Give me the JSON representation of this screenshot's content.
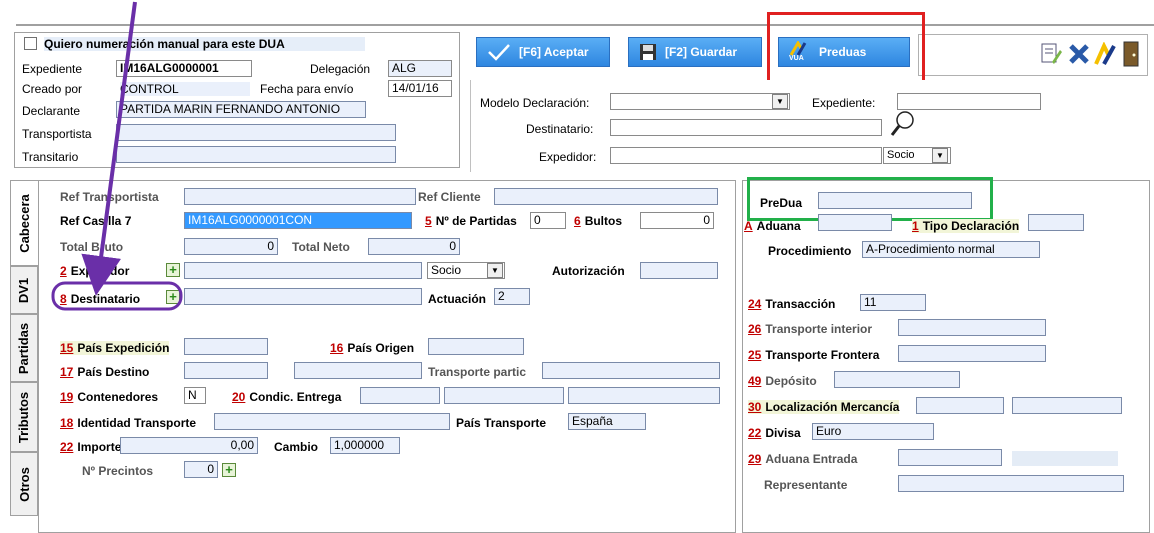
{
  "header": {
    "manual_numbering_label": "Quiero numeración manual para este DUA",
    "expediente_label": "Expediente",
    "expediente_value": "IM16ALG0000001",
    "delegacion_label": "Delegación",
    "delegacion_value": "ALG",
    "creado_label": "Creado por",
    "creado_value": "CONTROL",
    "fecha_label": "Fecha para envío",
    "fecha_value": "14/01/16",
    "declarante_label": "Declarante",
    "declarante_value": "PARTIDA MARIN FERNANDO ANTONIO",
    "transportista_label": "Transportista",
    "transitario_label": "Transitario"
  },
  "toolbar": {
    "aceptar_label": "[F6] Aceptar",
    "guardar_label": "[F2] Guardar",
    "preduas_label": "Preduas",
    "vua_badge": "VUA"
  },
  "search": {
    "modelo_label": "Modelo Declaración:",
    "expediente_label": "Expediente:",
    "destinatario_label": "Destinatario:",
    "expedidor_label": "Expedidor:",
    "socio_value": "Socio"
  },
  "tabs": [
    {
      "label": "Cabecera"
    },
    {
      "label": "DV1"
    },
    {
      "label": "Partidas"
    },
    {
      "label": "Tributos"
    },
    {
      "label": "Otros"
    }
  ],
  "left_form": {
    "ref_transportista": "Ref Transportista",
    "ref_cliente": "Ref Cliente",
    "ref_casilla": "Ref Casilla 7",
    "ref_casilla_value": "IM16ALG0000001CON",
    "n_partidas_num": "5",
    "n_partidas_label": "Nº de Partidas",
    "n_partidas_value": "0",
    "bultos_num": "6",
    "bultos_label": "Bultos",
    "bultos_value": "0",
    "total_bruto": "Total Bruto",
    "total_bruto_value": "0",
    "total_neto": "Total Neto",
    "total_neto_value": "0",
    "expedidor_num": "2",
    "expedidor_label": "Expedidor",
    "socio_value": "Socio",
    "autorizacion": "Autorización",
    "destinatario_num": "8",
    "destinatario_label": "Destinatario",
    "actuacion_label": "Actuación",
    "actuacion_value": "2",
    "pais_exp_num": "15",
    "pais_exp_label": "País Expedición",
    "pais_origen_num": "16",
    "pais_origen_label": "País Origen",
    "pais_destino_num": "17",
    "pais_destino_label": "País Destino",
    "transporte_partic": "Transporte partic",
    "contenedores_num": "19",
    "contenedores_label": "Contenedores",
    "contenedores_value": "N",
    "condic_num": "20",
    "condic_label": "Condic. Entrega",
    "identidad_num": "18",
    "identidad_label": "Identidad Transporte",
    "pais_transporte_label": "País Transporte",
    "pais_transporte_value": "España",
    "importe_num": "22",
    "importe_label": "Importe",
    "importe_value": "0,00",
    "cambio_label": "Cambio",
    "cambio_value": "1,000000",
    "precintos_label": "Nº Precintos",
    "precintos_value": "0"
  },
  "right_form": {
    "predua_label": "PreDua",
    "aduana_num": "A",
    "aduana_label": "Aduana",
    "tipo_num": "1",
    "tipo_label": "Tipo Declaración",
    "procedimiento_label": "Procedimiento",
    "procedimiento_value": "A-Procedimiento normal",
    "transaccion_num": "24",
    "transaccion_label": "Transacción",
    "transaccion_value": "11",
    "transp_interior_num": "26",
    "transp_interior_label": "Transporte interior",
    "transp_frontera_num": "25",
    "transp_frontera_label": "Transporte Frontera",
    "deposito_num": "49",
    "deposito_label": "Depósito",
    "localizacion_num": "30",
    "localizacion_label": "Localización Mercancía",
    "divisa_num": "22",
    "divisa_label": "Divisa",
    "divisa_value": "Euro",
    "aduana_entrada_num": "29",
    "aduana_entrada_label": "Aduana Entrada",
    "representante_label": "Representante"
  },
  "colors": {
    "accent_blue": "#2e86e0",
    "highlight_red": "#e02020",
    "highlight_green": "#22b04a",
    "annotation_purple": "#6a2fa8"
  }
}
